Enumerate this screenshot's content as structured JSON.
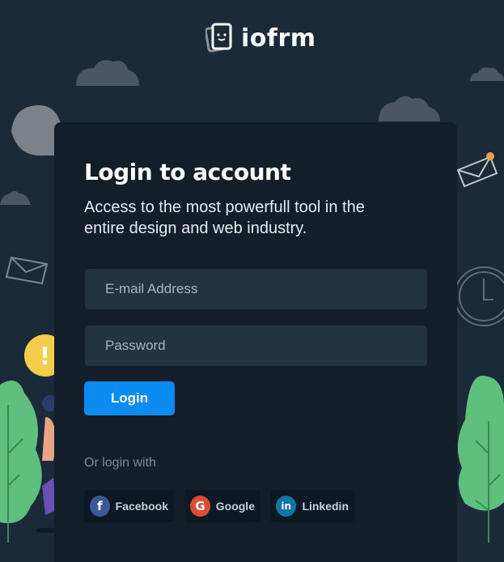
{
  "brand": {
    "name": "iofrm"
  },
  "login": {
    "title": "Login to account",
    "subtitle": "Access to the most powerfull tool in the entire design and web industry.",
    "email_placeholder": "E-mail Address",
    "password_placeholder": "Password",
    "button_label": "Login",
    "or_login_with": "Or login with"
  },
  "social": [
    {
      "label": "Facebook",
      "icon": "facebook-icon",
      "color": "#3b5998",
      "glyph": "f"
    },
    {
      "label": "Google",
      "icon": "google-icon",
      "color": "#dc4a38",
      "glyph": "G"
    },
    {
      "label": "Linkedin",
      "icon": "linkedin-icon",
      "color": "#0e76a8",
      "glyph": "in"
    }
  ],
  "colors": {
    "background": "#1a2a38",
    "card": "#121f2b",
    "input": "#223341",
    "accent": "#0c8cf0",
    "plant": "#5fbf7e"
  }
}
